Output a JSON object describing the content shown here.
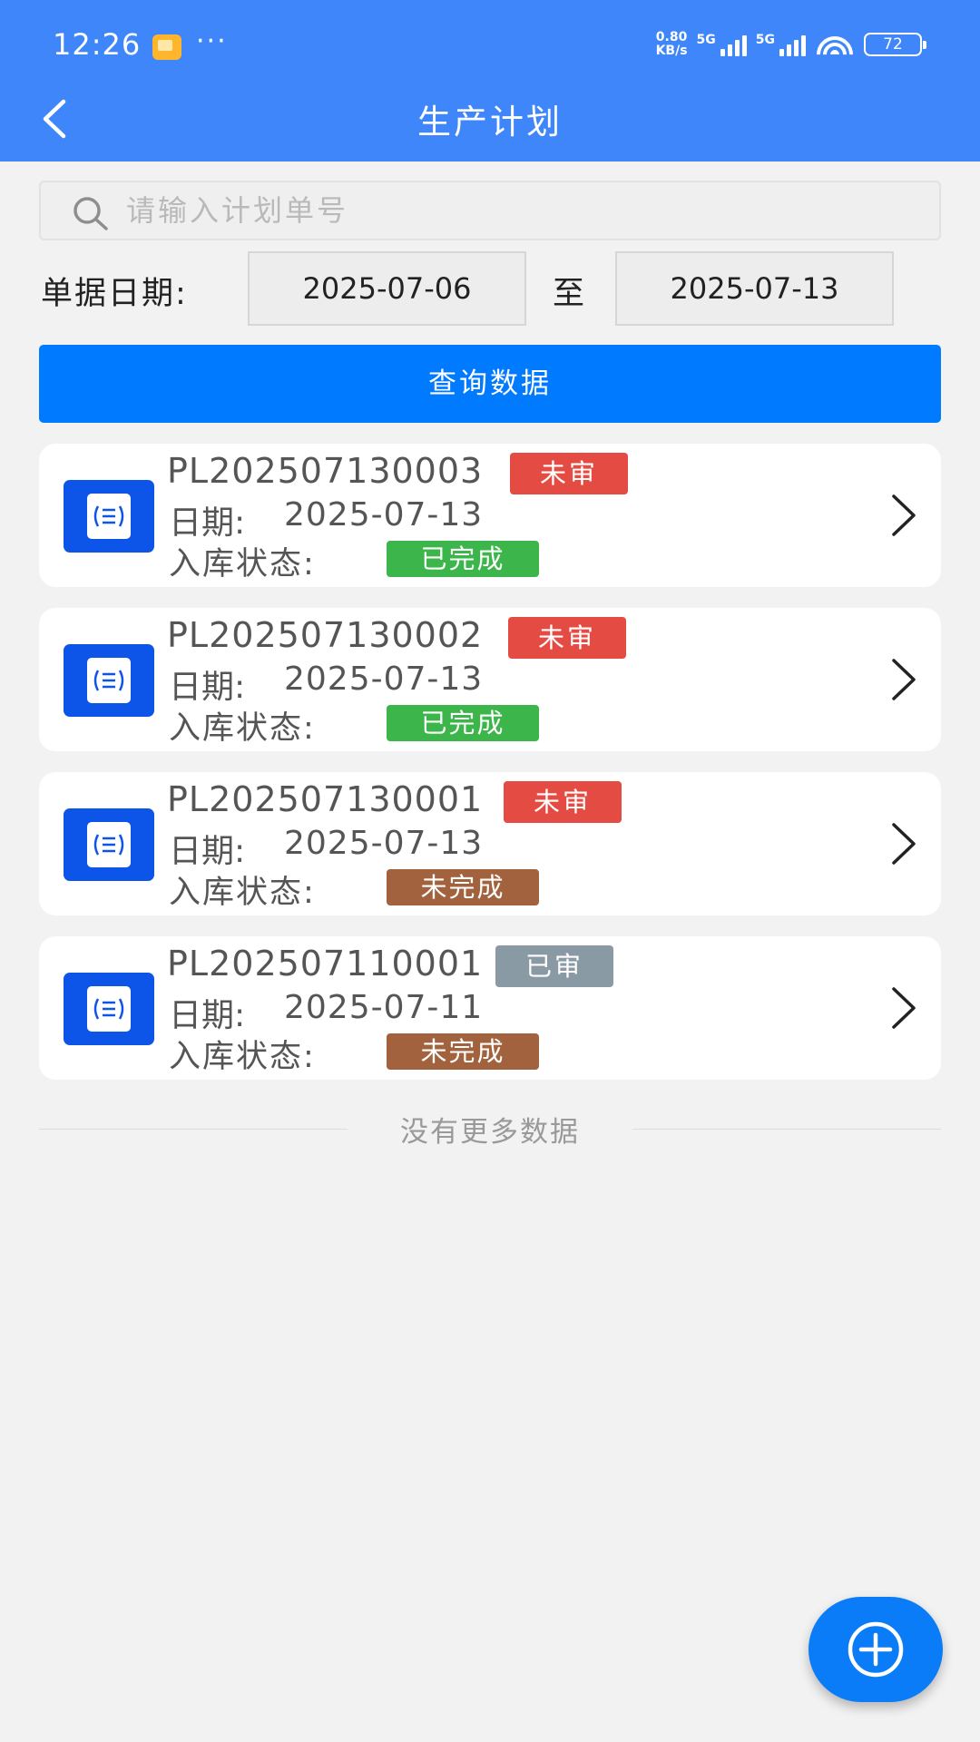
{
  "status_bar": {
    "time": "12:26",
    "more": "···",
    "net_speed_value": "0.80",
    "net_speed_unit": "KB/s",
    "sim1_label": "5G",
    "sim2_label": "5G",
    "wifi_sub": "6",
    "battery": "72",
    "notification_icon": "gallery-notification-icon"
  },
  "header": {
    "title": "生产计划",
    "back_icon": "chevron-left-icon"
  },
  "search": {
    "placeholder": "请输入计划单号",
    "value": ""
  },
  "date_filter": {
    "label": "单据日期:",
    "from": "2025-07-06",
    "separator": "至",
    "to": "2025-07-13"
  },
  "query_button": {
    "label": "查询数据"
  },
  "colors": {
    "header_bg": "#3e86f9",
    "primary": "#007aff",
    "unaudited": "#e44b43",
    "audited": "#8a9aa5",
    "completed": "#3cb54a",
    "incomplete": "#a1623d"
  },
  "plans": [
    {
      "no": "PL202507130003",
      "audit": "未审",
      "audit_color": "#e44b43",
      "date_label": "日期:",
      "date": "2025-07-13",
      "stock_label": "入库状态:",
      "stock_status": "已完成",
      "stock_color": "#3cb54a"
    },
    {
      "no": "PL202507130002",
      "audit": "未审",
      "audit_color": "#e44b43",
      "date_label": "日期:",
      "date": "2025-07-13",
      "stock_label": "入库状态:",
      "stock_status": "已完成",
      "stock_color": "#3cb54a"
    },
    {
      "no": "PL202507130001",
      "audit": "未审",
      "audit_color": "#e44b43",
      "date_label": "日期:",
      "date": "2025-07-13",
      "stock_label": "入库状态:",
      "stock_status": "未完成",
      "stock_color": "#a1623d"
    },
    {
      "no": "PL202507110001",
      "audit": "已审",
      "audit_color": "#8a9aa5",
      "date_label": "日期:",
      "date": "2025-07-11",
      "stock_label": "入库状态:",
      "stock_status": "未完成",
      "stock_color": "#a1623d"
    }
  ],
  "footer": {
    "no_more": "没有更多数据"
  },
  "fab": {
    "icon": "plus-circle-icon"
  }
}
